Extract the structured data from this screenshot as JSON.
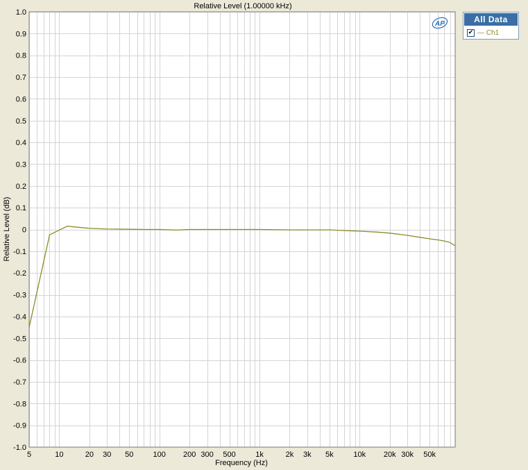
{
  "chart_data": {
    "type": "line",
    "title": "Relative Level (1.00000 kHz)",
    "xlabel": "Frequency (Hz)",
    "ylabel": "Relative Level (dB)",
    "xscale": "log",
    "xlim": [
      5,
      90000
    ],
    "ylim": [
      -1.0,
      1.0
    ],
    "grid": true,
    "x_tick_labels": [
      {
        "value": 5,
        "label": "5"
      },
      {
        "value": 10,
        "label": "10"
      },
      {
        "value": 20,
        "label": "20"
      },
      {
        "value": 30,
        "label": "30"
      },
      {
        "value": 50,
        "label": "50"
      },
      {
        "value": 100,
        "label": "100"
      },
      {
        "value": 200,
        "label": "200"
      },
      {
        "value": 300,
        "label": "300"
      },
      {
        "value": 500,
        "label": "500"
      },
      {
        "value": 1000,
        "label": "1k"
      },
      {
        "value": 2000,
        "label": "2k"
      },
      {
        "value": 3000,
        "label": "3k"
      },
      {
        "value": 5000,
        "label": "5k"
      },
      {
        "value": 10000,
        "label": "10k"
      },
      {
        "value": 20000,
        "label": "20k"
      },
      {
        "value": 30000,
        "label": "30k"
      },
      {
        "value": 50000,
        "label": "50k"
      }
    ],
    "y_tick_labels": [
      {
        "value": 1.0,
        "label": "1.0"
      },
      {
        "value": 0.9,
        "label": "0.9"
      },
      {
        "value": 0.8,
        "label": "0.8"
      },
      {
        "value": 0.7,
        "label": "0.7"
      },
      {
        "value": 0.6,
        "label": "0.6"
      },
      {
        "value": 0.5,
        "label": "0.5"
      },
      {
        "value": 0.4,
        "label": "0.4"
      },
      {
        "value": 0.3,
        "label": "0.3"
      },
      {
        "value": 0.2,
        "label": "0.2"
      },
      {
        "value": 0.1,
        "label": "0.1"
      },
      {
        "value": 0,
        "label": "0"
      },
      {
        "value": -0.1,
        "label": "-0.1"
      },
      {
        "value": -0.2,
        "label": "-0.2"
      },
      {
        "value": -0.3,
        "label": "-0.3"
      },
      {
        "value": -0.4,
        "label": "-0.4"
      },
      {
        "value": -0.5,
        "label": "-0.5"
      },
      {
        "value": -0.6,
        "label": "-0.6"
      },
      {
        "value": -0.7,
        "label": "-0.7"
      },
      {
        "value": -0.8,
        "label": "-0.8"
      },
      {
        "value": -0.9,
        "label": "-0.9"
      },
      {
        "value": -1.0,
        "label": "-1.0"
      }
    ],
    "series": [
      {
        "name": "Ch1",
        "color": "#8b8b2a",
        "x": [
          5,
          8,
          12,
          20,
          30,
          50,
          70,
          100,
          150,
          200,
          500,
          1000,
          2000,
          5000,
          7000,
          10000,
          15000,
          20000,
          30000,
          40000,
          50000,
          60000,
          70000,
          80000,
          90000
        ],
        "y": [
          -0.45,
          -0.025,
          0.015,
          0.005,
          0.002,
          0.001,
          0.0,
          0.0,
          -0.003,
          0.0,
          0.0,
          0.0,
          -0.002,
          -0.002,
          -0.005,
          -0.008,
          -0.012,
          -0.017,
          -0.027,
          -0.036,
          -0.043,
          -0.048,
          -0.053,
          -0.06,
          -0.075
        ]
      }
    ]
  },
  "legend": {
    "header": "All Data",
    "items": [
      {
        "label": "— Ch1",
        "checked": true,
        "check_glyph": "✔"
      }
    ]
  },
  "logo": {
    "text": "AP"
  },
  "colors": {
    "plot_background": "#ffffff",
    "grid": "#d4d4d4",
    "frame": "#808080",
    "window_background": "#ece9d8",
    "legend_header": "#3a6ea5",
    "logo": "#2a6fb8"
  }
}
